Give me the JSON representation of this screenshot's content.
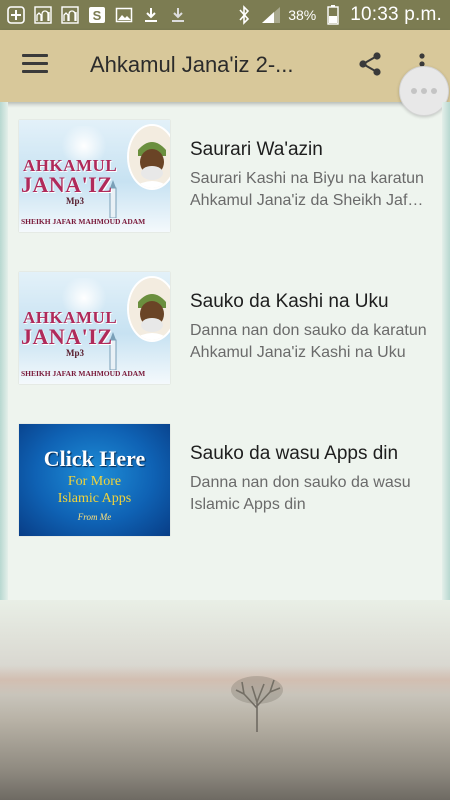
{
  "status_bar": {
    "battery_percent": "38%",
    "time": "10:33 p.m."
  },
  "app_bar": {
    "title": "Ahkamul Jana'iz 2-..."
  },
  "items": [
    {
      "title": "Saurari Wa'azin",
      "subtitle": "Saurari Kashi na Biyu na karatun Ahkamul Jana'iz da Sheikh Jafar Mahmoud Adam",
      "thumb": {
        "line1": "AHKAMUL",
        "line2": "JANA'IZ",
        "mp3": "Mp3",
        "author": "SHEIKH JAFAR MAHMOUD ADAM"
      }
    },
    {
      "title": "Sauko da Kashi na Uku",
      "subtitle": "Danna nan don sauko da karatun Ahkamul Jana'iz Kashi na Uku",
      "thumb": {
        "line1": "AHKAMUL",
        "line2": "JANA'IZ",
        "mp3": "Mp3",
        "author": "SHEIKH JAFAR MAHMOUD ADAM"
      }
    },
    {
      "title": "Sauko da wasu Apps din",
      "subtitle": "Danna nan don sauko da wasu Islamic Apps din",
      "thumb": {
        "headline": "Click Here",
        "sub1": "For More",
        "sub2": "Islamic Apps",
        "from": "From Me"
      }
    }
  ],
  "colors": {
    "status_bar": "#7c7c52",
    "app_bar": "#d8c89a",
    "title_text": "#2b2b2b"
  },
  "icons": {
    "status_left": [
      "add-icon",
      "mosque-app-icon",
      "mosque-app-icon",
      "s-app-icon",
      "image-icon",
      "download-icon",
      "download-icon"
    ],
    "status_right": [
      "bluetooth-icon",
      "signal-icon",
      "battery-icon"
    ],
    "app_bar": [
      "menu-icon",
      "share-icon",
      "more-vert-icon"
    ]
  }
}
